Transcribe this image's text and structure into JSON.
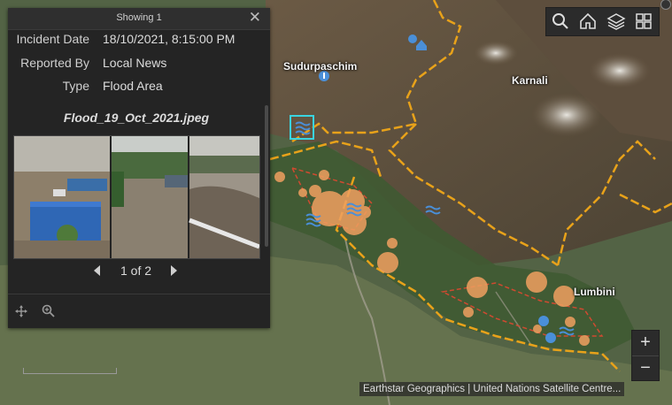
{
  "popup": {
    "title": "Showing 1",
    "fields": [
      {
        "key": "Incident Date",
        "value": "18/10/2021, 8:15:00 PM"
      },
      {
        "key": "Reported By",
        "value": "Local News"
      },
      {
        "key": "Type",
        "value": "Flood Area"
      }
    ],
    "image_title": "Flood_19_Oct_2021.jpeg",
    "pager": "1 of 2"
  },
  "map": {
    "labels": [
      "Sudurpaschim",
      "Karnali",
      "Lumbini"
    ],
    "attribution": "Earthstar Geographics | United Nations Satellite Centre...",
    "colors": {
      "boundary": "#e8a21a",
      "flood_marker": "#f0a060",
      "icon_blue": "#4a8fd8",
      "selection": "#39d4e0"
    }
  },
  "toolbar": {
    "icons": [
      "search-icon",
      "home-icon",
      "layers-icon",
      "basemap-gallery-icon"
    ]
  },
  "zoom": {
    "in_label": "+",
    "out_label": "−"
  }
}
